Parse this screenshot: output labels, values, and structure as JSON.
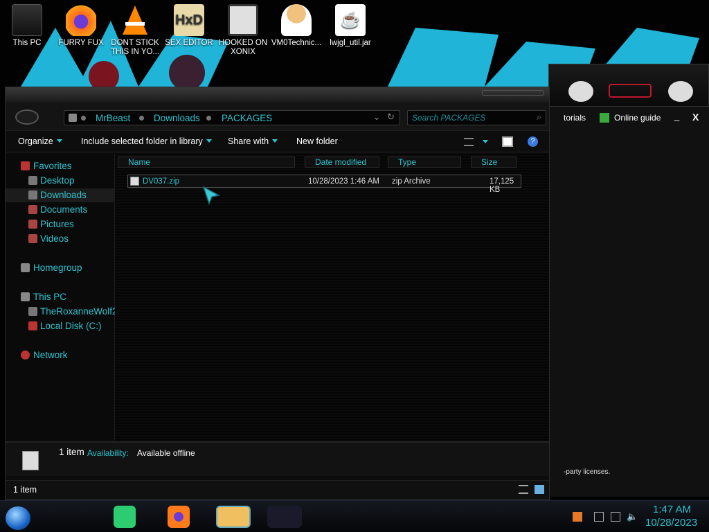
{
  "desktop": {
    "icons": [
      {
        "label": "This PC",
        "icon": "this-pc-icon"
      },
      {
        "label": "FURRY FUX",
        "icon": "firefox-icon"
      },
      {
        "label": "DONT STICK THIS IN YO...",
        "icon": "vlc-icon"
      },
      {
        "label": "SEX EDITOR",
        "icon": "hxd-icon"
      },
      {
        "label": "HOOKED ON XONIX",
        "icon": "game-icon"
      },
      {
        "label": "VM0Technic...",
        "icon": "doctor-icon"
      },
      {
        "label": "lwjgl_util.jar",
        "icon": "java-icon"
      }
    ]
  },
  "explorer": {
    "breadcrumb": [
      "MrBeast",
      "Downloads",
      "PACKAGES"
    ],
    "search_placeholder": "Search PACKAGES",
    "toolbar": {
      "organize": "Organize",
      "include": "Include selected folder in library",
      "share": "Share with",
      "new_folder": "New folder"
    },
    "sidebar": {
      "favorites": "Favorites",
      "desktop": "Desktop",
      "downloads": "Downloads",
      "documents": "Documents",
      "pictures": "Pictures",
      "videos": "Videos",
      "homegroup": "Homegroup",
      "this_pc": "This PC",
      "roxanne": "TheRoxanneWolf2",
      "local_disk": "Local Disk (C:)",
      "network": "Network"
    },
    "columns": {
      "name": "Name",
      "date": "Date modified",
      "type": "Type",
      "size": "Size"
    },
    "files": [
      {
        "name": "DV037.zip",
        "date": "10/28/2023 1:46 AM",
        "type": "zip Archive",
        "size": "17,125 KB"
      }
    ],
    "details": {
      "count": "1 item",
      "availability_label": "Availability:",
      "availability_value": "Available offline"
    },
    "status": {
      "count": "1 item"
    }
  },
  "gadget": {
    "tutorials": "torials",
    "online_guide": "Online guide",
    "minimize": "_",
    "close": "X",
    "licenses": "-party licenses."
  },
  "taskbar": {
    "time": "1:47 AM",
    "date": "10/28/2023"
  },
  "colors": {
    "accent": "#2ec3d0",
    "wallpaper_brush": "#1fb4d8",
    "alien_red": "#c0182a"
  }
}
